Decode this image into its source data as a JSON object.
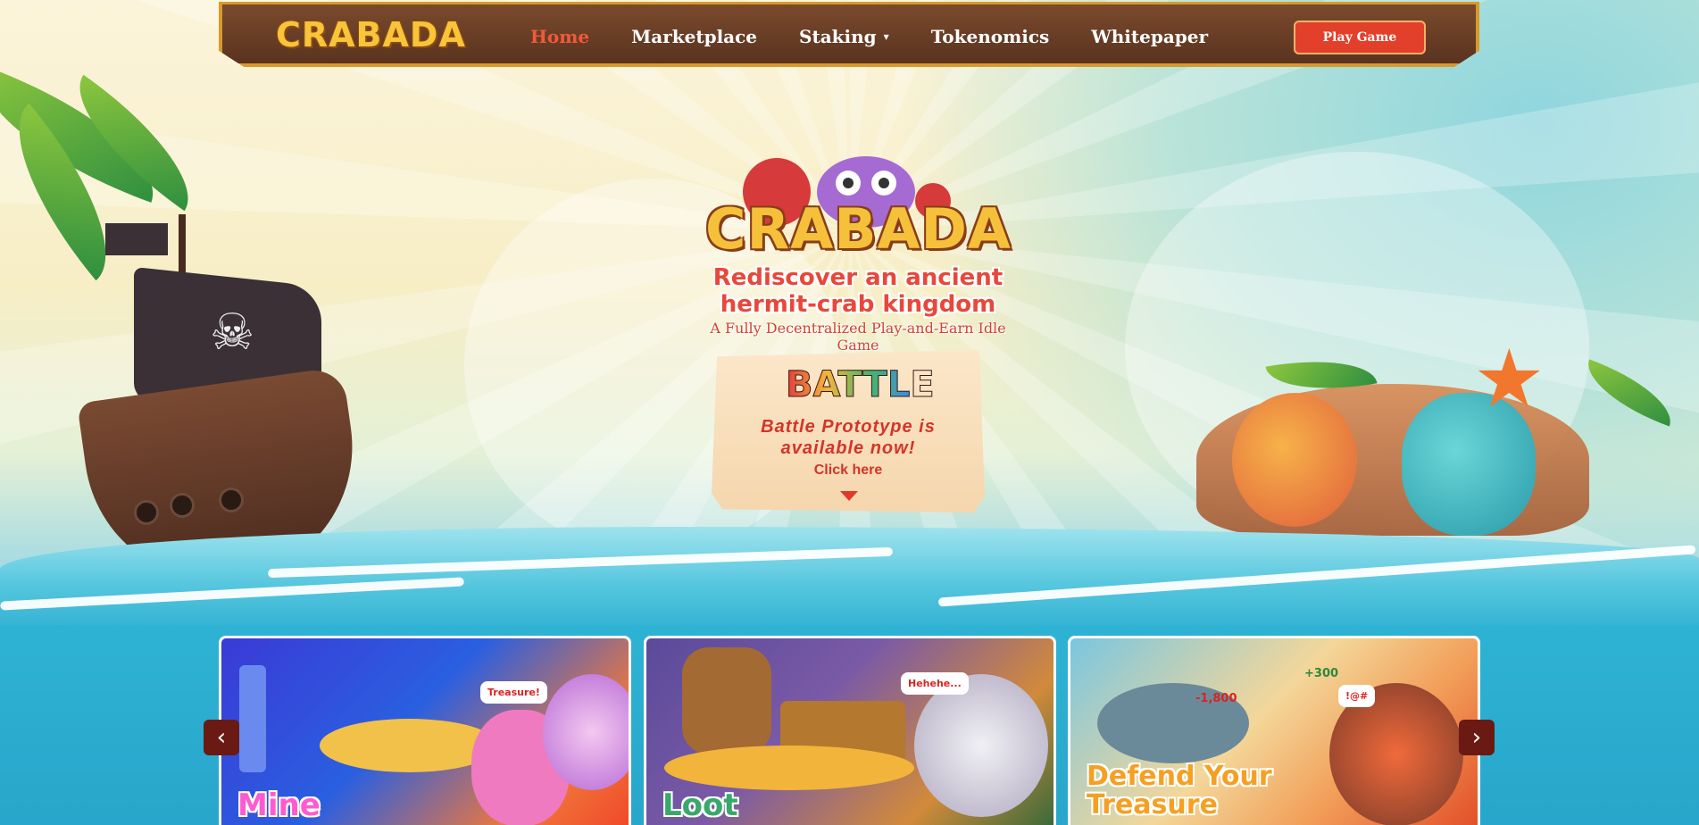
{
  "nav": {
    "logo": "CRABADA",
    "items": [
      {
        "label": "Home",
        "active": true
      },
      {
        "label": "Marketplace",
        "active": false
      },
      {
        "label": "Staking",
        "active": false,
        "dropdown": true
      },
      {
        "label": "Tokenomics",
        "active": false
      },
      {
        "label": "Whitepaper",
        "active": false
      }
    ],
    "caret": "▾",
    "play_label": "Play Game"
  },
  "hero": {
    "title": "CRABADA",
    "tagline_line1": "Rediscover an ancient",
    "tagline_line2": "hermit-crab kingdom",
    "subtitle": "A Fully Decentralized Play-and-Earn Idle Game",
    "battle_logo": "BATTLE",
    "battle_line1": "Battle Prototype is",
    "battle_line2": "available now!",
    "click_here": "Click here"
  },
  "cards": [
    {
      "label": "Mine",
      "bubble": "Treasure!"
    },
    {
      "label": "Loot",
      "bubble": "Hehehe..."
    },
    {
      "label_line1": "Defend Your",
      "label_line2": "Treasure",
      "bubble": "!@#",
      "score_up": "+300",
      "score_down": "-1,800"
    }
  ],
  "carousel": {
    "prev": "‹",
    "next": "›"
  },
  "colors": {
    "accent": "#e2402a",
    "nav_bg": "#5a3320",
    "nav_border": "#d79a2b",
    "active_link": "#ef5a3b",
    "logo": "#f7c43a"
  }
}
